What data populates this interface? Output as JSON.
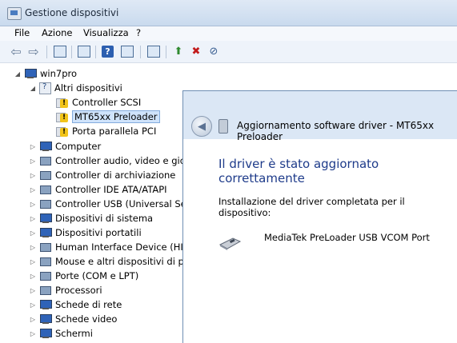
{
  "window": {
    "title": "Gestione dispositivi"
  },
  "menu": [
    "File",
    "Azione",
    "Visualizza",
    "?"
  ],
  "tree": {
    "root": "win7pro",
    "other_group": "Altri dispositivi",
    "other_children": [
      "Controller SCSI",
      "MT65xx Preloader",
      "Porta parallela PCI"
    ],
    "categories": [
      "Computer",
      "Controller audio, video e gioc",
      "Controller di archiviazione",
      "Controller IDE ATA/ATAPI",
      "Controller USB (Universal Seri",
      "Dispositivi di sistema",
      "Dispositivi portatili",
      "Human Interface Device (HID",
      "Mouse e altri dispositivi di pu",
      "Porte (COM e LPT)",
      "Processori",
      "Schede di rete",
      "Schede video",
      "Schermi"
    ]
  },
  "dialog": {
    "title": "Aggiornamento software driver - MT65xx Preloader",
    "heading": "Il driver è stato aggiornato correttamente",
    "message": "Installazione del driver completata per il dispositivo:",
    "device_name": "MediaTek PreLoader USB VCOM Port"
  }
}
